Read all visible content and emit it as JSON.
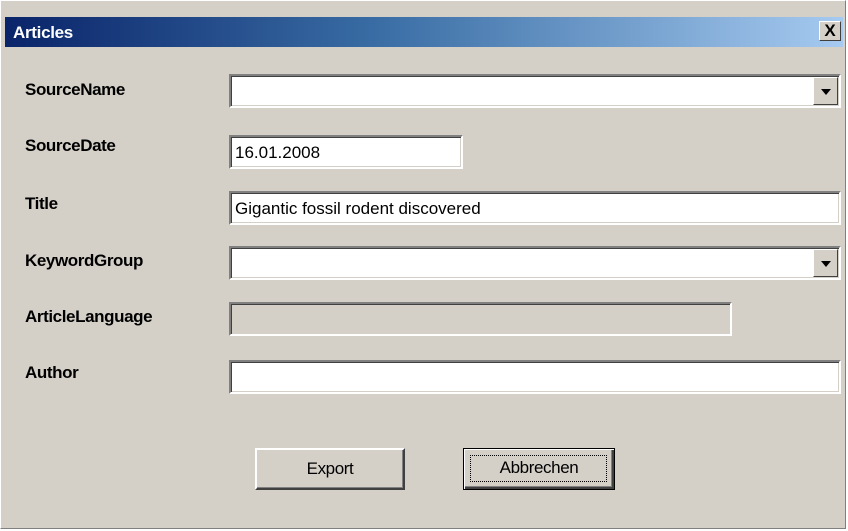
{
  "window": {
    "title": "Articles",
    "close_label": "X"
  },
  "form": {
    "source_name": {
      "label": "SourceName",
      "value": ""
    },
    "source_date": {
      "label": "SourceDate",
      "value": "16.01.2008"
    },
    "title": {
      "label": "Title",
      "value": "Gigantic fossil rodent discovered"
    },
    "keyword_group": {
      "label": "KeywordGroup",
      "value": ""
    },
    "article_language": {
      "label": "ArticleLanguage",
      "value": ""
    },
    "author": {
      "label": "Author",
      "value": ""
    }
  },
  "buttons": {
    "export_label": "Export",
    "cancel_label": "Abbrechen"
  },
  "colors": {
    "window_bg": "#d4d0c8",
    "title_gradient_start": "#0a246a",
    "title_gradient_end": "#a6caf0"
  }
}
